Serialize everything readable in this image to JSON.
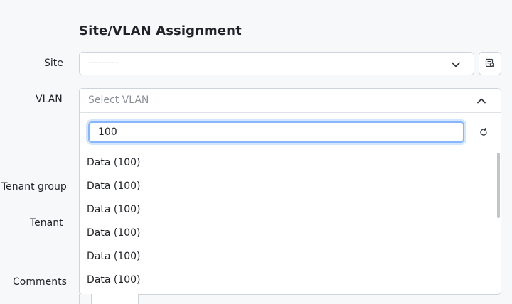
{
  "section": {
    "title": "Site/VLAN Assignment"
  },
  "labels": {
    "site": "Site",
    "vlan": "VLAN",
    "tenant_group": "Tenant group",
    "tenant": "Tenant",
    "comments": "Comments"
  },
  "site_select": {
    "value": "---------",
    "icon": "chevron-down-icon"
  },
  "selector_button": {
    "icon": "search-list-icon"
  },
  "vlan_select": {
    "placeholder": "Select VLAN",
    "icon": "chevron-up-icon"
  },
  "vlan_dropdown": {
    "search_value": "100",
    "refresh_icon": "refresh-icon",
    "options": [
      "Data (100)",
      "Data (100)",
      "Data (100)",
      "Data (100)",
      "Data (100)",
      "Data (100)"
    ]
  }
}
